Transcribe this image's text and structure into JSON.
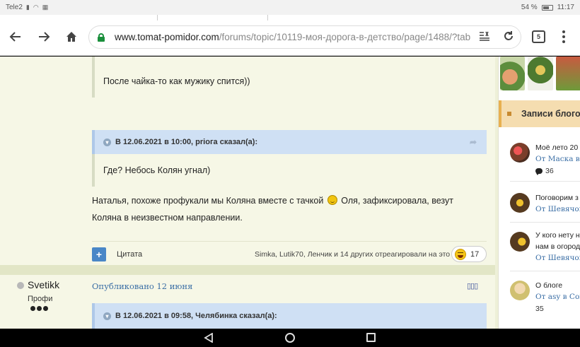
{
  "status_bar": {
    "carrier": "Tele2",
    "battery_percent": "54 %",
    "time": "11:17"
  },
  "browser": {
    "url_domain": "www.tomat-pomidor.com",
    "url_path": "/forums/topic/10119-моя-дорога-в-детство/page/1488/?tab",
    "tabs_count": "5"
  },
  "posts": {
    "quote_top_text": "После чайка-то как мужику спится))",
    "quote1_header": "В 12.06.2021 в 10:00, prioга сказал(а):",
    "quote1_text": "Где? Небось Колян угнал)",
    "post_text_line1a": "Наталья, похоже профукали мы Коляна вместе с тачкой",
    "post_text_line1b": "Оля, зафиксировала, везут",
    "post_text_line2": "Коляна в неизвестном направлении.",
    "quote_button_label": "Цитата",
    "reactions_text": "Simka, Lutik70, Ленчик и 14 других отреагировали на это",
    "reaction_count": "17"
  },
  "post2": {
    "author": "Svetikk",
    "rank": "Профи",
    "published": "Опубликовано 12 июня",
    "menu": "⋯",
    "quote_header": "В 12.06.2021 в 09:58, Челябинка сказал(а):"
  },
  "sidebar": {
    "blog_header": "Записи блогов",
    "items": [
      {
        "title": "Моё лето 20",
        "author": "От Маска в С",
        "count": "36"
      },
      {
        "title": "Поговорим з",
        "author": "От Шевячок"
      },
      {
        "title": "У кого нету н",
        "title2": "нам в огород",
        "author": "От Шевячок"
      },
      {
        "title": "О блоге",
        "author": "От asy в Сов",
        "count": "35"
      }
    ]
  },
  "colors": {
    "accent_link": "#3a6ea5",
    "quote_header_bg": "#cfe0f4",
    "page_bg": "#f6f7e6",
    "secure_lock": "#1a8f3c"
  }
}
